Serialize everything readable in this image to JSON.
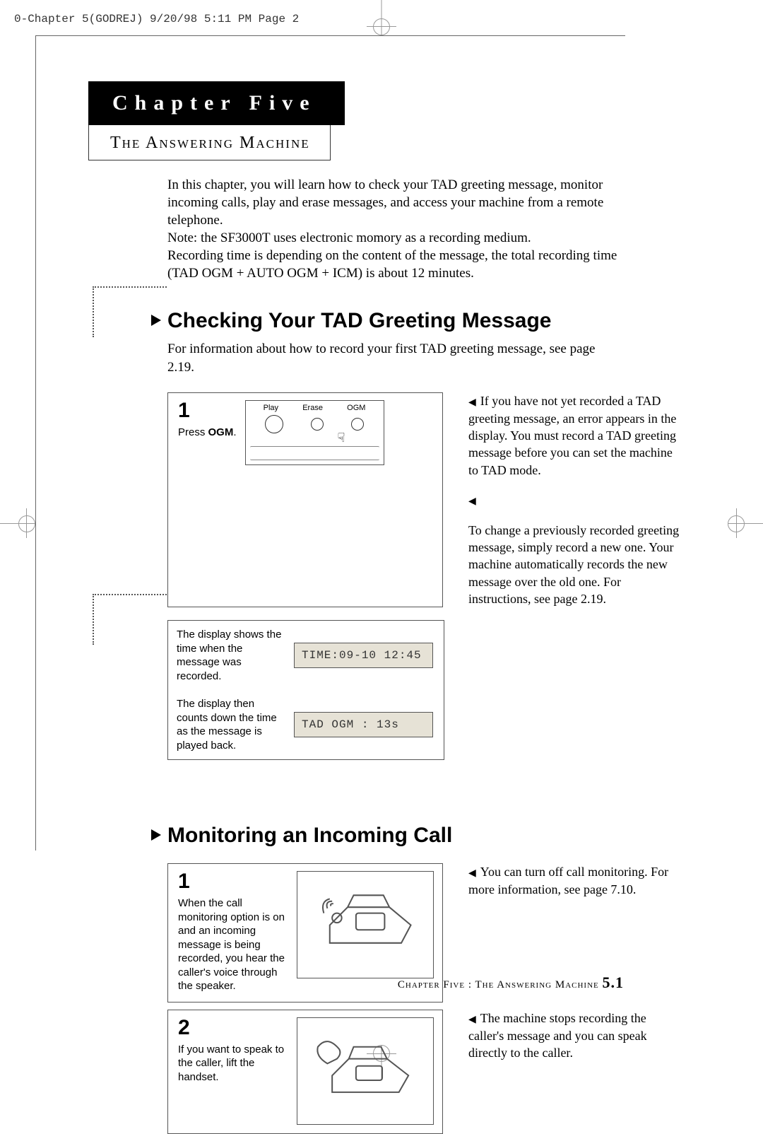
{
  "print_header": "0-Chapter 5(GODREJ)  9/20/98 5:11 PM  Page 2",
  "chapter_bar": "Chapter  Five",
  "subtitle": "The  Answering  Machine",
  "intro_lines": [
    "In this chapter, you will learn how to check your TAD greeting message, monitor incoming calls, play and erase messages, and access your machine from a remote telephone.",
    "Note: the SF3000T uses electronic momory as a recording medium.",
    "Recording time is depending on the content of the message, the total recording time (TAD OGM + AUTO OGM + ICM) is about 12 minutes."
  ],
  "section1": {
    "title": "Checking Your TAD Greeting Message",
    "sub": "For information about how to record your first TAD greeting message, see page 2.19.",
    "step1_num": "1",
    "step1_text_pre": "Press ",
    "step1_text_bold": "OGM",
    "step1_text_post": ".",
    "panel_labels": {
      "a": "Play",
      "b": "Erase",
      "c": "OGM"
    },
    "right1": "If you have not yet recorded a TAD greeting message, an error appears in the display. You must record a TAD greeting message before you can set the machine to TAD mode.",
    "right2": "To change a previously recorded greeting message, simply record a new one. Your machine automatically records the new message over the old one. For instructions, see page 2.19.",
    "row1_txt": "The display shows the time when the message was recorded.",
    "row1_lcd": "TIME:09-10 12:45",
    "row2_txt": "The display then counts down the time as the message is played back.",
    "row2_lcd": "TAD OGM : 13s"
  },
  "section2": {
    "title": "Monitoring an Incoming Call",
    "step1_num": "1",
    "step1_text": "When the call monitoring option is on and an incoming message is being recorded, you hear the caller's voice through the speaker.",
    "right1": "You can turn off call monitoring. For more information, see page 7.10.",
    "step2_num": "2",
    "step2_text": "If you want to speak to the caller, lift the handset.",
    "right2": "The machine stops recording the caller's message and you can speak directly to the caller."
  },
  "footer_text": "Chapter Five : The Answering Machine ",
  "footer_page": "5.1"
}
